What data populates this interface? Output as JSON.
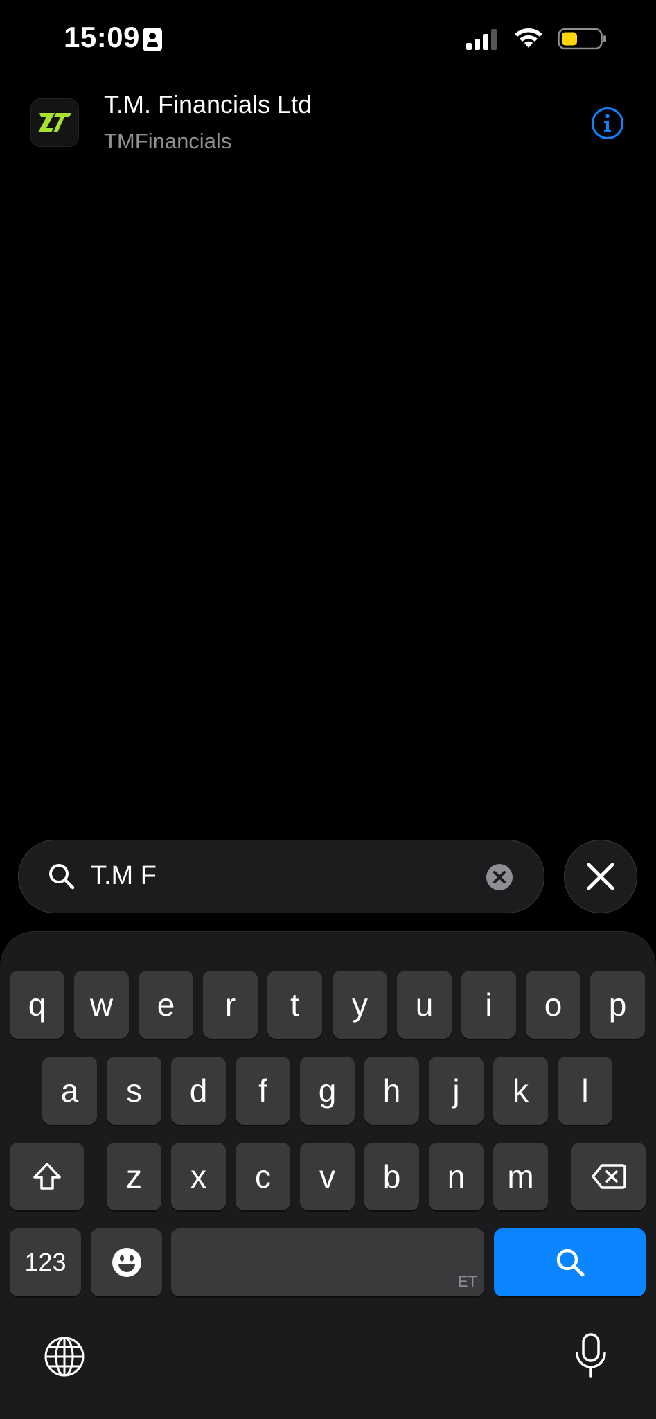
{
  "status_bar": {
    "time": "15:09"
  },
  "result": {
    "name": "T.M. Financials Ltd",
    "subtitle": "TMFinancials",
    "icon_accent": "#a6e22e"
  },
  "search": {
    "value": "T.M F"
  },
  "keyboard": {
    "row1": [
      "q",
      "w",
      "e",
      "r",
      "t",
      "y",
      "u",
      "i",
      "o",
      "p"
    ],
    "row2": [
      "a",
      "s",
      "d",
      "f",
      "g",
      "h",
      "j",
      "k",
      "l"
    ],
    "row3": [
      "z",
      "x",
      "c",
      "v",
      "b",
      "n",
      "m"
    ],
    "numbers_label": "123",
    "space_hint": "ET"
  },
  "colors": {
    "accent_blue": "#0a84ff",
    "battery_yellow": "#ffd60a"
  }
}
